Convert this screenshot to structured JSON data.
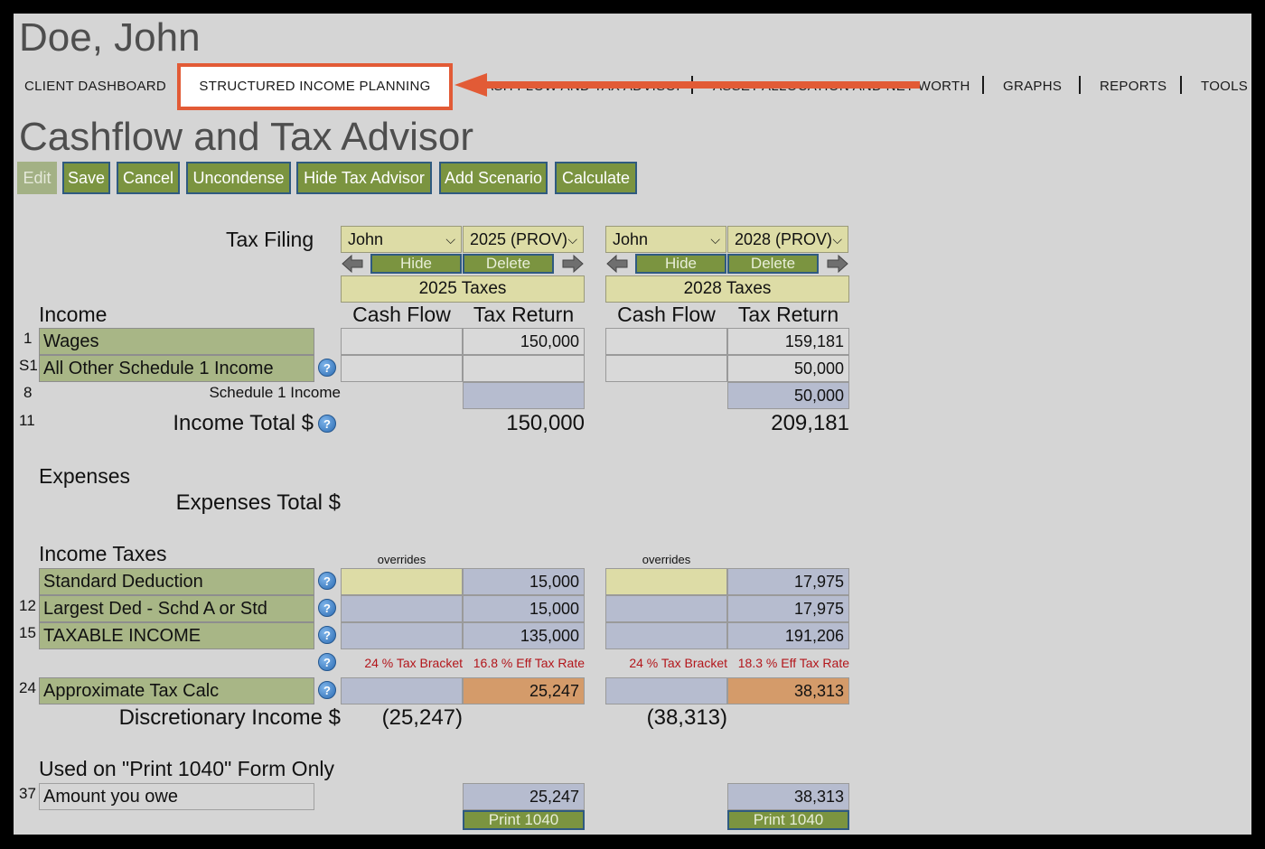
{
  "client": {
    "name": "Doe, John"
  },
  "nav": {
    "client_dashboard": "CLIENT DASHBOARD",
    "structured_income": "STRUCTURED INCOME PLANNING",
    "cashflow_tax": "CASH FLOW AND TAX ADVISOR",
    "asset_allocation": "ASSET ALLOCATION AND NET WORTH",
    "graphs": "GRAPHS",
    "reports": "REPORTS",
    "tools": "TOOLS"
  },
  "annotation": {
    "highlight_color": "#e25b36"
  },
  "page": {
    "title": "Cashflow and Tax Advisor"
  },
  "toolbar": {
    "edit": "Edit",
    "save": "Save",
    "cancel": "Cancel",
    "uncondense": "Uncondense",
    "hide_tax_advisor": "Hide Tax Advisor",
    "add_scenario": "Add Scenario",
    "calculate": "Calculate"
  },
  "labels": {
    "tax_filing": "Tax Filing",
    "income": "Income",
    "expenses": "Expenses",
    "expenses_total": "Expenses Total $",
    "income_taxes": "Income Taxes",
    "print_section": "Used on \"Print 1040\" Form Only",
    "cash_flow": "Cash Flow",
    "tax_return": "Tax Return",
    "overrides": "overrides",
    "hide": "Hide",
    "delete": "Delete",
    "print_1040": "Print 1040",
    "schedule1_income": "Schedule 1 Income",
    "income_total": "Income Total $",
    "discretionary_income": "Discretionary Income $"
  },
  "rows": {
    "wages": {
      "num": "1",
      "label": "Wages"
    },
    "other_sched1": {
      "num": "S1",
      "label": "All Other Schedule 1 Income"
    },
    "sched1": {
      "num": "8"
    },
    "income_total": {
      "num": "11"
    },
    "std_deduction": {
      "label": "Standard Deduction"
    },
    "largest_ded": {
      "num": "12",
      "label": "Largest Ded - Schd A or Std"
    },
    "taxable_income": {
      "num": "15",
      "label": "TAXABLE INCOME"
    },
    "approx_tax": {
      "num": "24",
      "label": "Approximate Tax Calc"
    },
    "amount_owe": {
      "num": "37",
      "label": "Amount you owe"
    }
  },
  "scenarios": [
    {
      "person": "John",
      "year": "2025 (PROV)",
      "header": "2025 Taxes",
      "wages": "150,000",
      "other_sched1": "",
      "sched1": "",
      "income_total": "150,000",
      "std_deduction": "15,000",
      "largest_ded": "15,000",
      "taxable_income": "135,000",
      "bracket": "24 % Tax Bracket",
      "eff_rate": "16.8 % Eff Tax Rate",
      "approx_tax": "25,247",
      "discretionary": "(25,247)",
      "amount_owe": "25,247"
    },
    {
      "person": "John",
      "year": "2028 (PROV)",
      "header": "2028 Taxes",
      "wages": "159,181",
      "other_sched1": "50,000",
      "sched1": "50,000",
      "income_total": "209,181",
      "std_deduction": "17,975",
      "largest_ded": "17,975",
      "taxable_income": "191,206",
      "bracket": "24 % Tax Bracket",
      "eff_rate": "18.3 % Eff Tax Rate",
      "approx_tax": "38,313",
      "discretionary": "(38,313)",
      "amount_owe": "38,313"
    }
  ]
}
